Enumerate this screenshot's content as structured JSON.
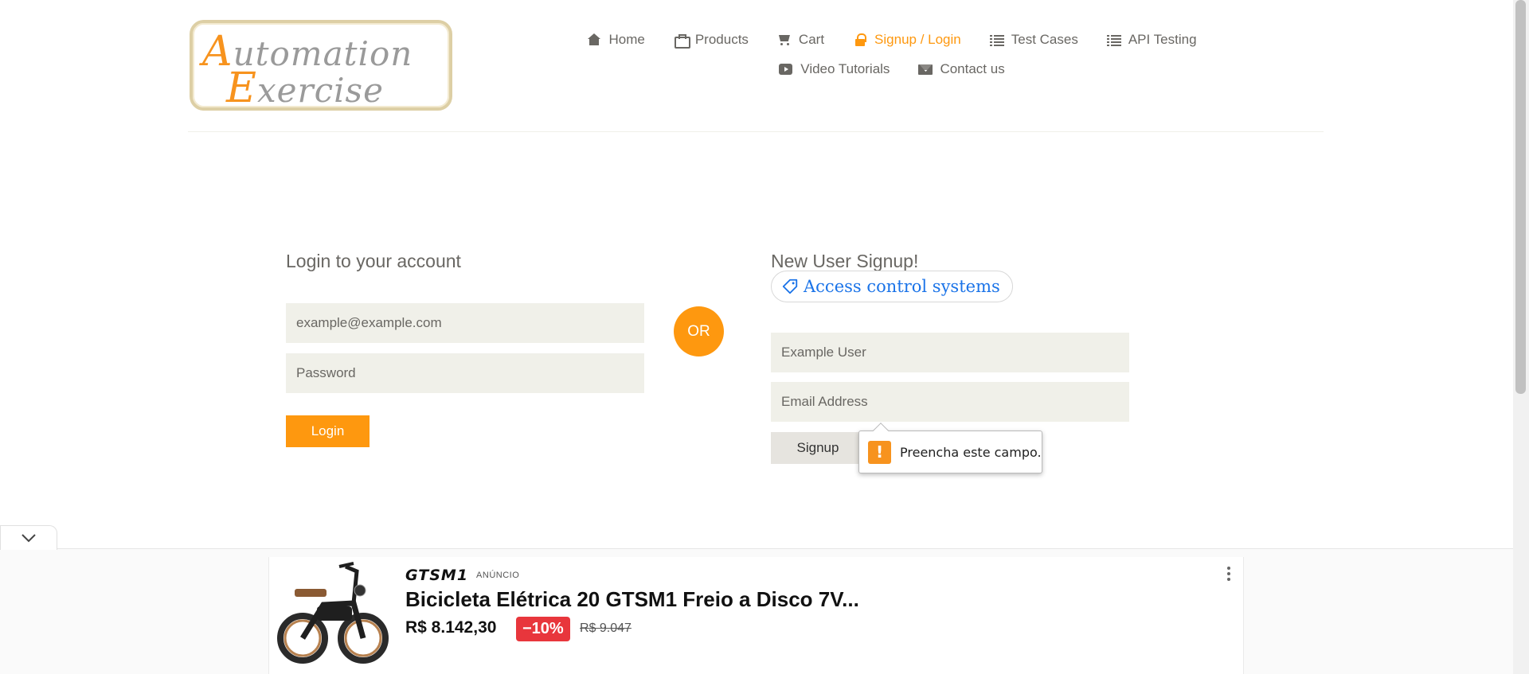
{
  "logo": {
    "line1_cap": "A",
    "line1_rest": "utomation",
    "line2_cap": "E",
    "line2_rest": "xercise"
  },
  "nav": {
    "row1": [
      {
        "label": "Home",
        "icon": "home-icon"
      },
      {
        "label": "Products",
        "icon": "briefcase-icon"
      },
      {
        "label": "Cart",
        "icon": "cart-icon"
      },
      {
        "label": "Signup / Login",
        "icon": "lock-icon",
        "active": true
      },
      {
        "label": "Test Cases",
        "icon": "list-icon"
      },
      {
        "label": "API Testing",
        "icon": "list-icon"
      }
    ],
    "row2": [
      {
        "label": "Video Tutorials",
        "icon": "youtube-icon"
      },
      {
        "label": "Contact us",
        "icon": "envelope-icon"
      }
    ],
    "active_color": "#fe980f"
  },
  "login": {
    "title": "Login to your account",
    "email_value": "example@example.com",
    "password_placeholder": "Password",
    "button": "Login"
  },
  "or_label": "OR",
  "signup": {
    "title": "New User Signup!",
    "tag_label": "Access control systems",
    "name_value": "Example User",
    "email_placeholder": "Email Address",
    "button": "Signup"
  },
  "validation_tooltip": {
    "message": "Preencha este campo."
  },
  "ad": {
    "brand": "GTSM1",
    "badge": "ANÚNCIO",
    "title": "Bicicleta Elétrica 20 GTSM1 Freio a Disco 7V...",
    "price": "R$ 8.142,30",
    "discount": "−10%",
    "old_price": "R$ 9.047"
  },
  "colors": {
    "accent": "#fe980f",
    "field_bg": "#f0f0e9",
    "discount": "#e8363c",
    "link": "#1a73e8"
  }
}
